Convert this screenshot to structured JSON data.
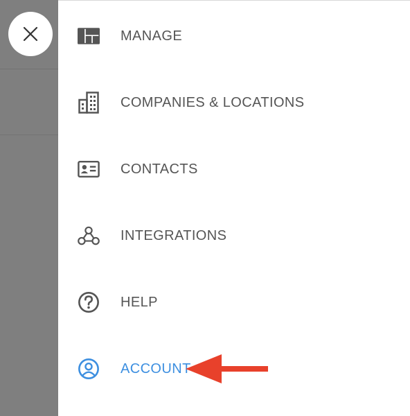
{
  "menu": {
    "close_icon": "close-icon",
    "items": [
      {
        "label": "MANAGE",
        "icon": "dashboard-layout-icon",
        "active": false
      },
      {
        "label": "COMPANIES & LOCATIONS",
        "icon": "building-icon",
        "active": false
      },
      {
        "label": "CONTACTS",
        "icon": "contact-card-icon",
        "active": false
      },
      {
        "label": "INTEGRATIONS",
        "icon": "webhook-icon",
        "active": false
      },
      {
        "label": "HELP",
        "icon": "help-circle-icon",
        "active": false
      },
      {
        "label": "ACCOUNT",
        "icon": "account-circle-icon",
        "active": true
      }
    ]
  },
  "colors": {
    "text": "#555555",
    "active": "#3d8fe0",
    "overlay": "#7f7f7f",
    "annotation_arrow": "#e8412b"
  }
}
